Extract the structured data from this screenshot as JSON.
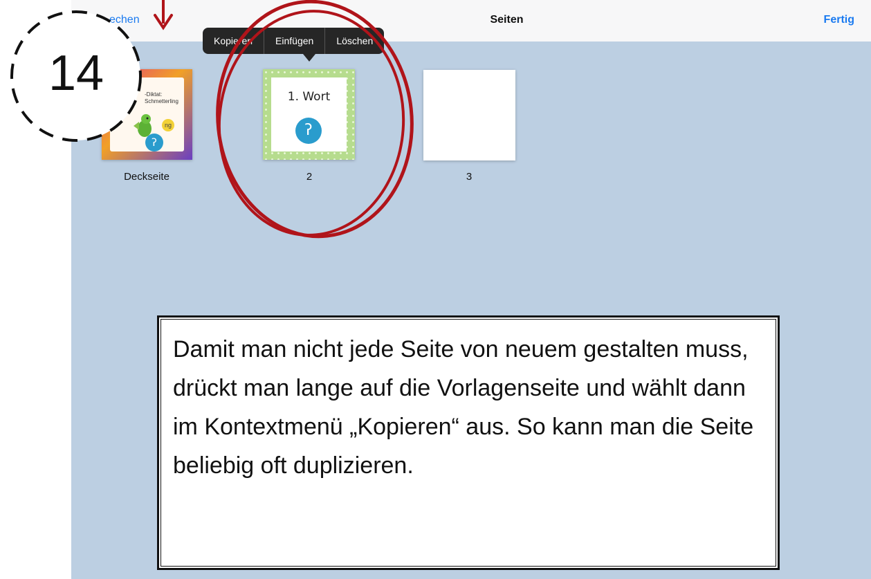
{
  "navbar": {
    "left_label": "echen",
    "title": "Seiten",
    "right_label": "Fertig"
  },
  "context_menu": {
    "items": [
      "Kopieren",
      "Einfügen",
      "Löschen"
    ]
  },
  "pages": [
    {
      "label": "Deckseite",
      "thumb_text": "-Diktat:\nSchmetterling",
      "badge": "ng"
    },
    {
      "label": "2",
      "thumb_text": "1. Wort"
    },
    {
      "label": "3"
    }
  ],
  "annotation": {
    "step_number": "14",
    "highlight_color": "#b0141a"
  },
  "callout": {
    "text": "Damit man nicht jede Seite von neuem gestalten muss, drückt man lange auf die Vorlagenseite und wählt dann im Kontextmenü „Kopieren“ aus. So kann man die Seite beliebig oft duplizieren."
  }
}
